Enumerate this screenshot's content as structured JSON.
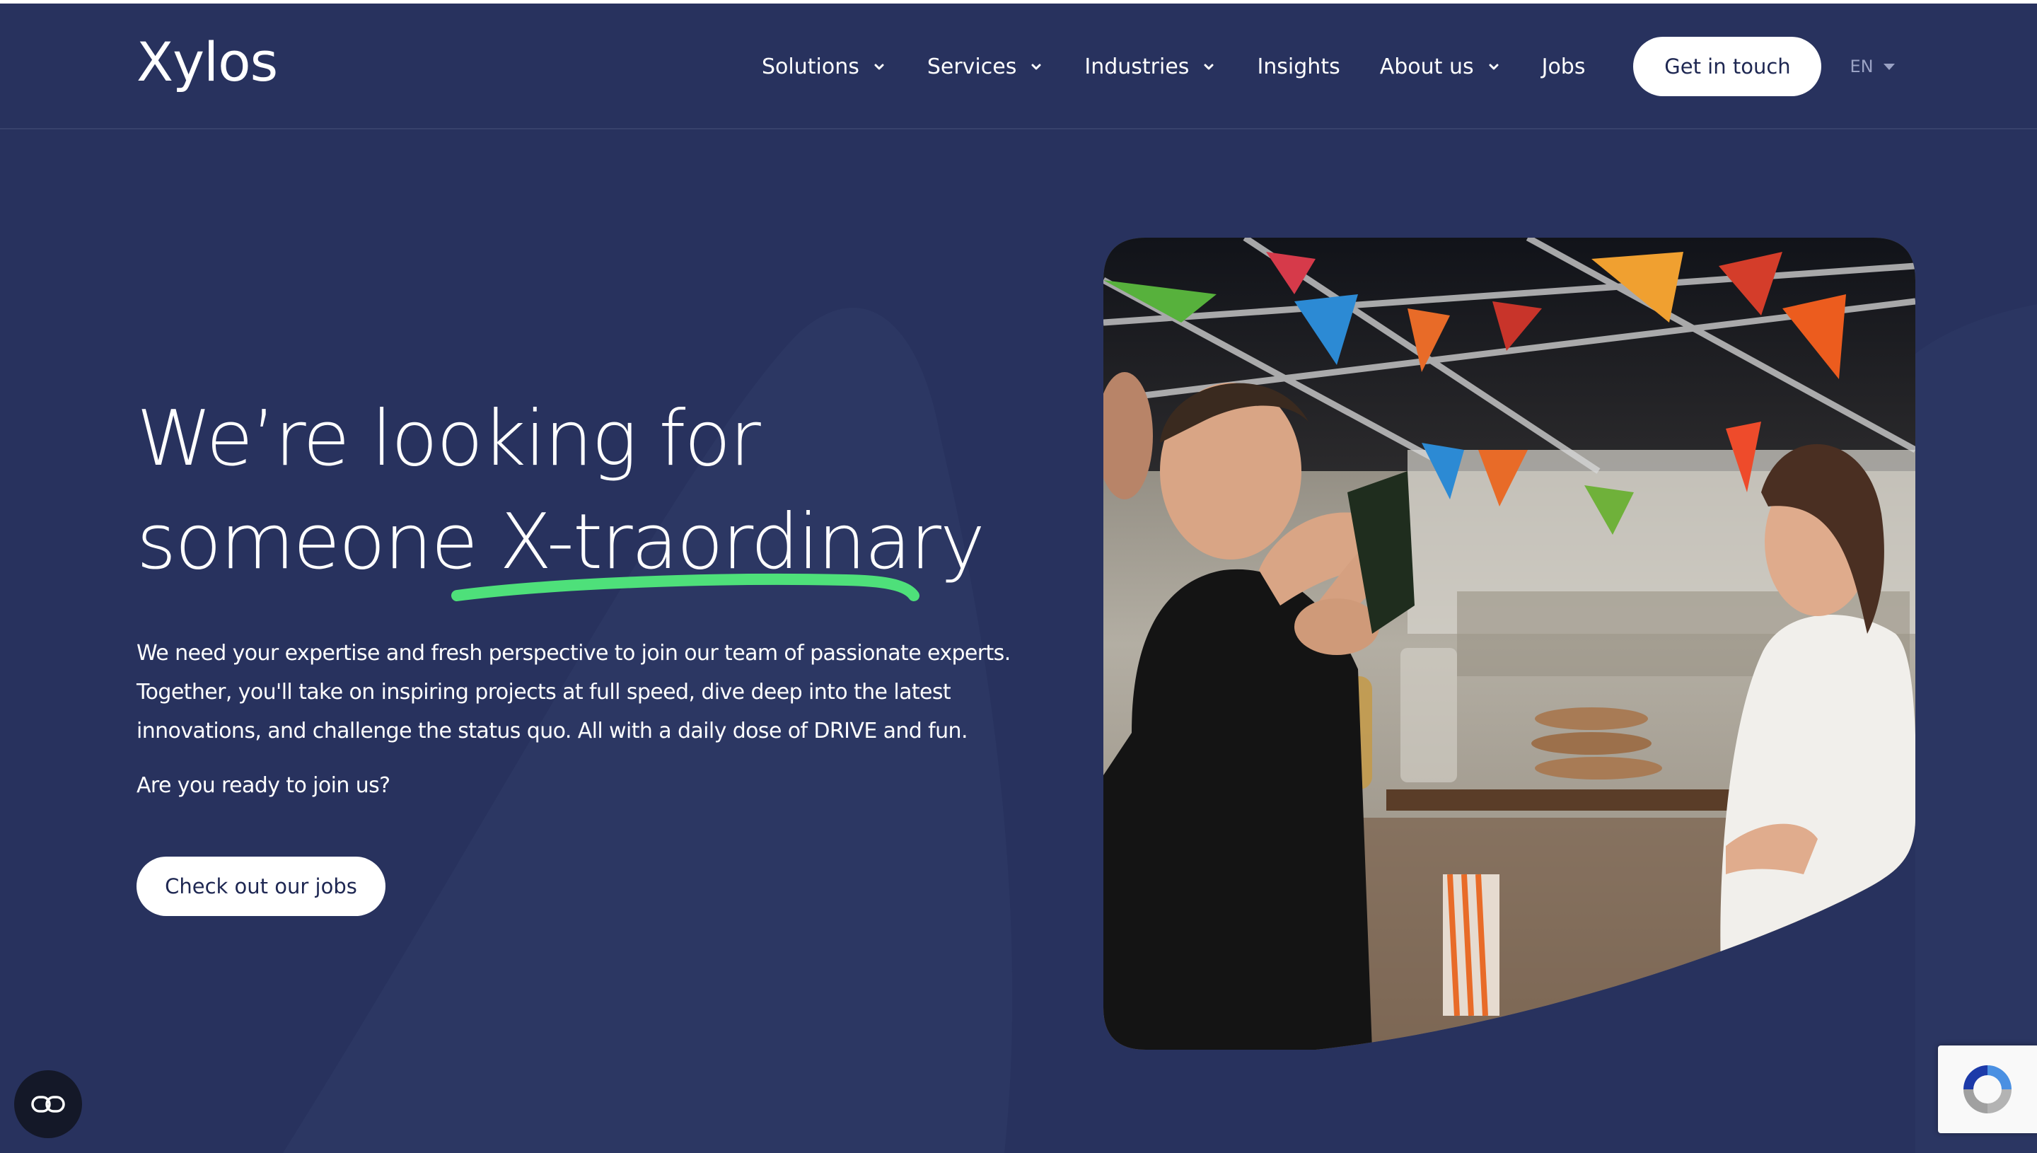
{
  "brand": {
    "logo_text": "Xylos"
  },
  "nav": {
    "items": [
      {
        "label": "Solutions",
        "has_dropdown": true
      },
      {
        "label": "Services",
        "has_dropdown": true
      },
      {
        "label": "Industries",
        "has_dropdown": true
      },
      {
        "label": "Insights",
        "has_dropdown": false
      },
      {
        "label": "About us",
        "has_dropdown": true
      },
      {
        "label": "Jobs",
        "has_dropdown": false
      }
    ],
    "cta_label": "Get in touch",
    "language": "EN"
  },
  "hero": {
    "headline_line1": "We’re looking for",
    "headline_line2": "someone X-traordinary",
    "paragraph": "We need your expertise and fresh perspective to join our team of passionate experts. Together, you'll take on inspiring projects at full speed, dive deep into the latest innovations, and challenge the status quo. All with a daily dose of DRIVE and fun.",
    "question": "Are you ready to join us?",
    "cta_label": "Check out our jobs"
  },
  "widgets": {
    "accessibility_icon": "accessibility-icon",
    "recaptcha_icon": "recaptcha-icon"
  },
  "colors": {
    "background": "#28325e",
    "accent_green": "#4ee07a",
    "button_text": "#1e2752"
  }
}
